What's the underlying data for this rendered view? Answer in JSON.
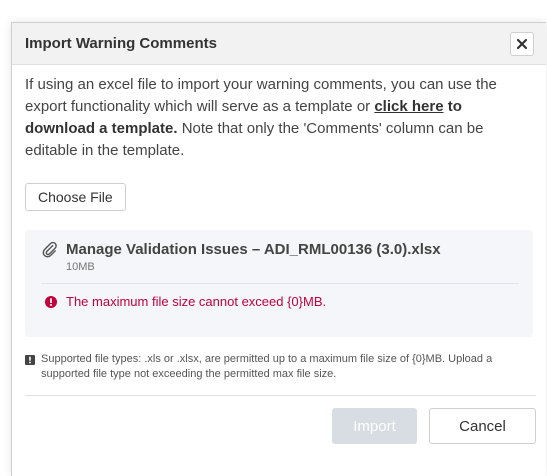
{
  "modal": {
    "title": "Import Warning Comments",
    "close_icon": "close-icon"
  },
  "intro": {
    "text_before_link": "If using an excel file to import your warning comments, you can use the export functionality which will serve as a template or ",
    "link_text": "click here",
    "bold_after_link": " to download a template.",
    "text_after_bold": " Note that only the 'Comments' column can be editable in the template."
  },
  "choose_file": {
    "label": "Choose File"
  },
  "file": {
    "icon": "paperclip-icon",
    "name": "Manage Validation Issues – ADI_RML00136 (3.0).xlsx",
    "size": "10MB"
  },
  "error": {
    "icon": "error-icon",
    "message": "The maximum file size cannot exceed {0}MB.",
    "color": "#c3003a"
  },
  "info": {
    "icon": "info-icon",
    "text": "Supported file types: .xls or .xlsx, are permitted up to a maximum file size of {0}MB. Upload a supported file type not exceeding the permitted max file size."
  },
  "footer": {
    "import_label": "Import",
    "cancel_label": "Cancel"
  }
}
